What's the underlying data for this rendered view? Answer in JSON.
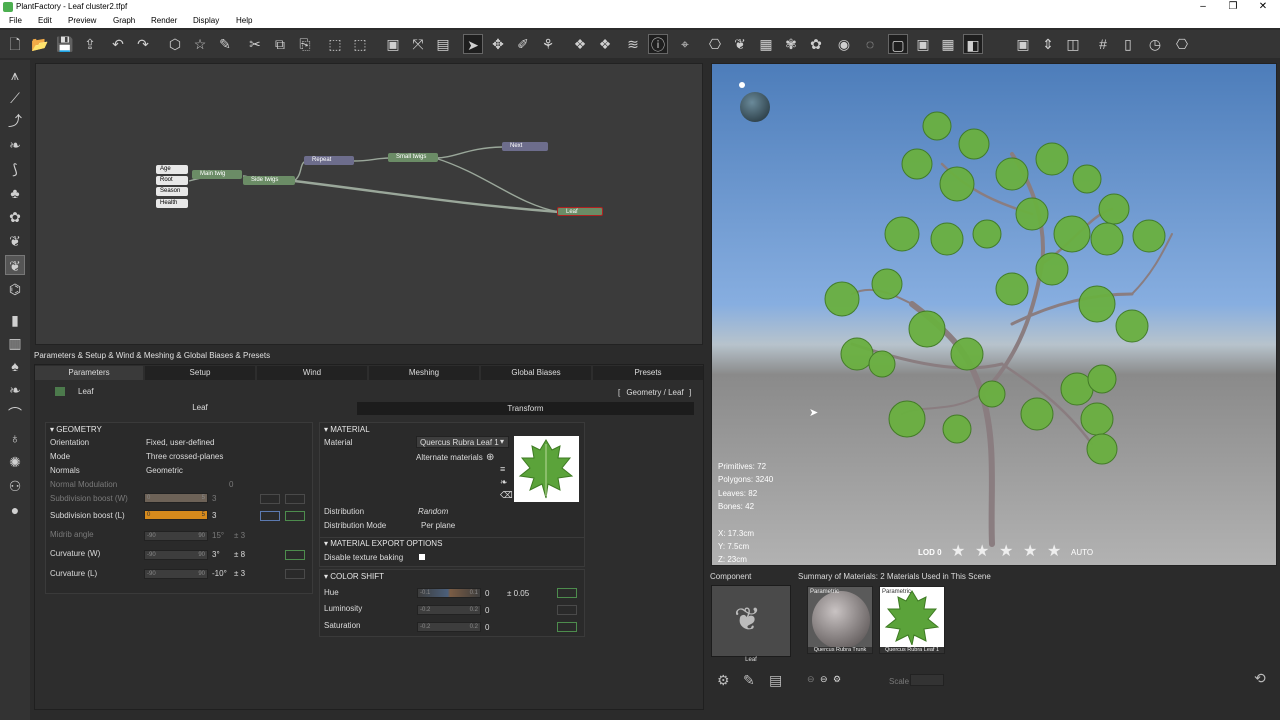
{
  "window": {
    "title": "PlantFactory - Leaf cluster2.tfpf"
  },
  "menu": [
    "File",
    "Edit",
    "Preview",
    "Graph",
    "Render",
    "Display",
    "Help"
  ],
  "graph": {
    "inputs": [
      "Age",
      "Root",
      "Season",
      "Health"
    ],
    "nodes": {
      "main_twig": "Main twig",
      "side_twigs": "Side twigs",
      "repeat": "Repeat",
      "small_twigs": "Small twigs",
      "next": "Next",
      "leaf": "Leaf"
    }
  },
  "params": {
    "title": "Parameters & Setup & Wind & Meshing & Global Biases & Presets",
    "tabs": [
      "Parameters",
      "Setup",
      "Wind",
      "Meshing",
      "Global Biases",
      "Presets"
    ],
    "node_name": "Leaf",
    "path": "Geometry / Leaf",
    "subtabs": {
      "leaf": "Leaf",
      "transform": "Transform"
    },
    "geometry": {
      "header": "GEOMETRY",
      "orientation": {
        "label": "Orientation",
        "value": "Fixed, user-defined"
      },
      "mode": {
        "label": "Mode",
        "value": "Three crossed-planes"
      },
      "normals": {
        "label": "Normals",
        "value": "Geometric"
      },
      "normal_mod": {
        "label": "Normal Modulation",
        "value": "0"
      },
      "subdiv_w": {
        "label": "Subdivision boost (W)",
        "min": "0",
        "max": "5",
        "value": "3"
      },
      "subdiv_l": {
        "label": "Subdivision boost (L)",
        "min": "0",
        "max": "5",
        "value": "3"
      },
      "midrib": {
        "label": "Midrib angle",
        "min": "-90",
        "max": "90",
        "value": "15°",
        "var": "± 3"
      },
      "curv_w": {
        "label": "Curvature (W)",
        "min": "-90",
        "max": "90",
        "value": "3°",
        "var": "± 8"
      },
      "curv_l": {
        "label": "Curvature (L)",
        "min": "-90",
        "max": "90",
        "value": "-10°",
        "var": "± 3"
      }
    },
    "material": {
      "header": "MATERIAL",
      "material_label": "Material",
      "material_value": "Quercus Rubra Leaf 1",
      "alternate": "Alternate materials",
      "distribution_label": "Distribution",
      "distribution_value": "Random",
      "dist_mode_label": "Distribution Mode",
      "dist_mode_value": "Per plane"
    },
    "export": {
      "header": "MATERIAL EXPORT OPTIONS",
      "bake_label": "Disable texture baking"
    },
    "colorshift": {
      "header": "COLOR SHIFT",
      "hue": {
        "label": "Hue",
        "min": "-0.1",
        "max": "0.1",
        "value": "0",
        "var": "± 0.05"
      },
      "lum": {
        "label": "Luminosity",
        "min": "-0.2",
        "max": "0.2",
        "value": "0"
      },
      "sat": {
        "label": "Saturation",
        "min": "-0.2",
        "max": "0.2",
        "value": "0"
      }
    }
  },
  "viewport": {
    "stats": [
      "Primitives: 72",
      "Polygons: 3240",
      "Leaves: 82",
      "Bones: 42"
    ],
    "coords": [
      "X: 17.3cm",
      "Y: 7.5cm",
      "Z: 23cm"
    ],
    "lod": "LOD 0",
    "auto": "AUTO"
  },
  "component": {
    "header": "Component",
    "name": "Leaf"
  },
  "materials": {
    "header": "Summary of Materials: 2 Materials Used in This Scene",
    "items": [
      {
        "name": "Quercus Rubra Trunk",
        "tag": "Parametric"
      },
      {
        "name": "Quercus Rubra Leaf 1",
        "tag": "Parametric"
      }
    ],
    "scale_label": "Scale"
  }
}
